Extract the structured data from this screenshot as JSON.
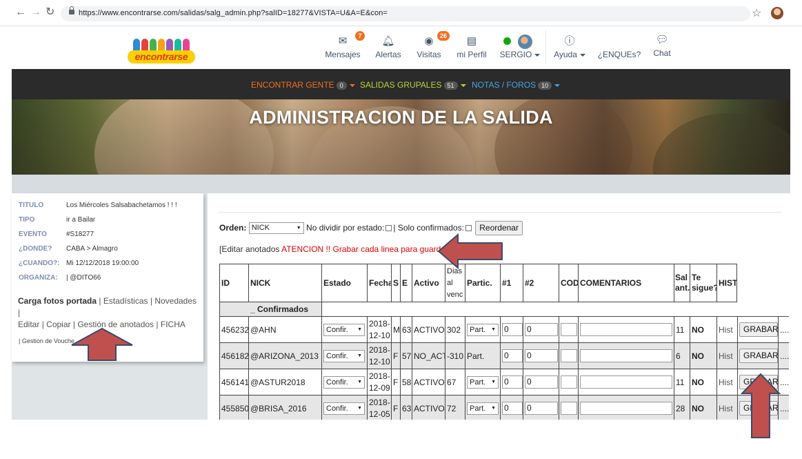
{
  "browser": {
    "url": "https://www.encontrarse.com/salidas/salg_admin.php?salID=18277&VISTA=U&A=E&con="
  },
  "logo": {
    "text": "encontrarse"
  },
  "topnav": {
    "mensajes": {
      "label": "Mensajes",
      "badge": "7"
    },
    "alertas": {
      "label": "Alertas"
    },
    "visitas": {
      "label": "Visitas",
      "badge": "26"
    },
    "perfil": {
      "label": "mi Perfil"
    },
    "user": {
      "label": "SERGIO"
    },
    "ayuda": {
      "label": "Ayuda"
    },
    "enques": {
      "label": "¿ENQUEs?"
    },
    "chat": {
      "label": "Chat"
    }
  },
  "menubar": {
    "encontrar": {
      "label": "ENCONTRAR GENTE",
      "count": "0",
      "color": "#f07022"
    },
    "salidas": {
      "label": "SALIDAS GRUPALES",
      "count": "51",
      "color": "#b8d33c"
    },
    "notas": {
      "label": "NOTAS / FOROS",
      "count": "10",
      "color": "#4aa3df"
    }
  },
  "hero": {
    "title": "ADMINISTRACION DE LA SALIDA"
  },
  "info": {
    "rows": [
      {
        "k": "TITULO",
        "v": "Los Miércoles Salsabachetamos ! ! !"
      },
      {
        "k": "TIPO",
        "v": "ir a Bailar"
      },
      {
        "k": "EVENTO",
        "v": "#S18277"
      },
      {
        "k": "¿DONDE?",
        "v": "CABA > Almagro"
      },
      {
        "k": "¿CUANDO?:",
        "v": "Mi 12/12/2018 19:00:00"
      },
      {
        "k": "ORGANIZA:",
        "v": "| @DITO66"
      }
    ],
    "links": {
      "carga": "Carga fotos portada",
      "estadisticas": "Estadísticas",
      "novedades": "Novedades",
      "editar": "Editar",
      "copiar": "Copiar",
      "gestion": "Gestión de anotados",
      "ficha": "FICHA"
    },
    "voucher": "| Gestion de Vouche"
  },
  "controls": {
    "orden_label": "Orden:",
    "orden_value": "NICK",
    "no_dividir": "No dividir por estado:",
    "solo_confirmados": "| Solo confirmados:",
    "reordenar": "Reordenar",
    "edit_prefix": "[Editar anotados",
    "edit_warning": "ATENCION !! Grabar cada linea para guardar",
    "edit_suffix": "]"
  },
  "table": {
    "headers": {
      "id": "ID",
      "nick": "NICK",
      "estado": "Estado",
      "fecha": "Fecha",
      "s": "S",
      "e": "E",
      "activo": "Activo",
      "dias1": "Dias",
      "dias2": "al",
      "dias3": "venc",
      "partic": "Partic.",
      "n1": "#1",
      "n2": "#2",
      "cod": "COD",
      "comentarios": "COMENTARIOS",
      "sal1": "Sal",
      "sal2": "ant.",
      "te1": "Te",
      "te2": "sigue?",
      "hist": "HIST"
    },
    "group_label": "_ Confirmados",
    "rows": [
      {
        "id": "456232",
        "nick": "@AHN",
        "estado": "Confir.",
        "fecha1": "2018-",
        "fecha2": "12-10",
        "s": "M",
        "e": "63",
        "activo": "ACTIVO",
        "dias": "302",
        "partic": "Part.",
        "n1": "0",
        "n2": "0",
        "sal": "11",
        "sigue": "NO",
        "hist": "Hist",
        "grabar": "GRABAR",
        "more": "...."
      },
      {
        "id": "456182",
        "nick": "@ARIZONA_2013",
        "estado": "Confir.",
        "fecha1": "2018-",
        "fecha2": "12-10",
        "s": "F",
        "e": "57",
        "activo": "NO_ACT",
        "dias": "-310",
        "partic": "Part.",
        "n1": "0",
        "n2": "0",
        "sal": "6",
        "sigue": "NO",
        "hist": "Hist",
        "grabar": "GRABAR",
        "more": "...."
      },
      {
        "id": "456141",
        "nick": "@ASTUR2018",
        "estado": "Confir.",
        "fecha1": "2018-",
        "fecha2": "12-09",
        "s": "F",
        "e": "58",
        "activo": "ACTIVO",
        "dias": "67",
        "partic": "Part.",
        "n1": "0",
        "n2": "0",
        "sal": "11",
        "sigue": "NO",
        "hist": "Hist",
        "grabar": "GRABAR",
        "more": "...."
      },
      {
        "id": "455850",
        "nick": "@BRISA_2016",
        "estado": "Confir.",
        "fecha1": "2018-",
        "fecha2": "12-05",
        "s": "F",
        "e": "63",
        "activo": "ACTIVO",
        "dias": "72",
        "partic": "Part.",
        "n1": "0",
        "n2": "0",
        "sal": "28",
        "sigue": "NO",
        "hist": "Hist",
        "grabar": "GRABAR",
        "more": "...."
      }
    ]
  },
  "colors": {
    "arrow_fill": "#c0504d",
    "arrow_stroke": "#3a4a6b",
    "active_green": "#1d8a1d",
    "warning_red": "#e00000",
    "menubar_bg": "#2b2b2b"
  }
}
